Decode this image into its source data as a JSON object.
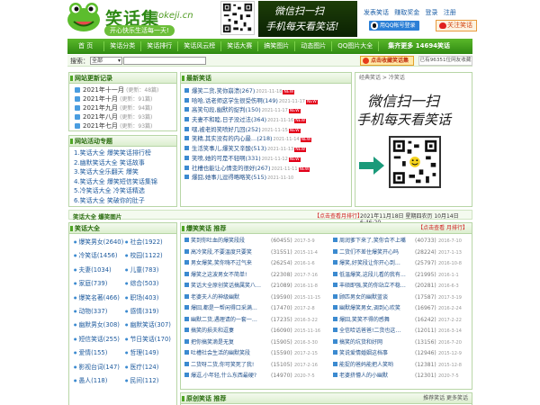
{
  "header": {
    "logo_cn": "笑话集",
    "logo_en": "Jokeji.cn",
    "slogan": "开心快乐生活每一天!",
    "banner_line1": "微信扫一扫",
    "banner_line2": "手机每天看笑话!",
    "links": [
      "发表笑话",
      "赚取奖金",
      "登录",
      "注册"
    ],
    "qq_login": "用QQ帐号登录",
    "weibo_follow": "关注笑话"
  },
  "nav": {
    "items": [
      "首 页",
      "笑话分类",
      "笑话排行",
      "笑话风云榜",
      "笑话大赛",
      "搞笑图片",
      "动态图片",
      "QQ图片大全",
      "集齐更多 14694笑话"
    ]
  },
  "search": {
    "label": "搜索：",
    "select_value": "全部",
    "input_value": ""
  },
  "favorite_button": "点击收藏笑话集",
  "online_count": "已有96351位网友收藏",
  "updates": {
    "title": "网站更新记录",
    "items": [
      {
        "month": "2021年十一月",
        "count": "(更新：48篇)"
      },
      {
        "month": "2021年十月",
        "count": "(更新：91篇)"
      },
      {
        "month": "2021年九月",
        "count": "(更新：94篇)"
      },
      {
        "month": "2021年八月",
        "count": "(更新：93篇)"
      },
      {
        "month": "2021年七月",
        "count": "(更新：93篇)"
      }
    ]
  },
  "topics": {
    "title": "网站活动专题",
    "items": [
      "1.笑话大全 爆笑笑话排行榜",
      "2.幽默笑话大全 笑话故事",
      "3.笑话大全乐翻天 爆笑",
      "4.笑话大全 爆笑短信笑话集锦",
      "5.冷笑话大全 冷笑话精选",
      "6.笑话大全 笑破你的肚子"
    ]
  },
  "latest": {
    "title": "最新笑话",
    "items": [
      {
        "title": "爆笑二货,笑你崩溃",
        "count": "(267)",
        "date": "2021-11-18",
        "new": "NEW"
      },
      {
        "title": "哈哈,话老师这学生很受伤啊",
        "count": "(149)",
        "date": "2021-11-17",
        "new": "NEW"
      },
      {
        "title": "高笑句段,幽默的捉判",
        "count": "(150)",
        "date": "2021-11-17",
        "new": "NEW"
      },
      {
        "title": "夫妻不和睦,日子没过法",
        "count": "(364)",
        "date": "2021-11-16",
        "new": "NEW"
      },
      {
        "title": "嘿,被老妈笑喷好几回",
        "count": "(252)",
        "date": "2021-11-15",
        "new": "NEW"
      },
      {
        "title": "笑精,其实没有的内心最…",
        "count": "(218)",
        "date": "2021-11-14",
        "new": "NEW"
      },
      {
        "title": "生活笑事儿,爆笑又辛酸",
        "count": "(513)",
        "date": "2021-11-13",
        "new": "NEW"
      },
      {
        "title": "笑喷,她的可是不轻啊",
        "count": "(331)",
        "date": "2021-11-12",
        "new": "NEW"
      },
      {
        "title": "社槽也能让心情变的很好",
        "count": "(267)",
        "date": "2021-11-11",
        "new": "NEW"
      },
      {
        "title": "爆囧,她事儿逗得略略笑",
        "count": "(515)",
        "date": "2021-11-10",
        "new": ""
      }
    ]
  },
  "promo": {
    "breadcrumb": "经典笑话 > 冷笑话",
    "line1": "微信扫一扫",
    "line2": "手机每天看笑话"
  },
  "timebar": {
    "title": "笑话大全 爆笑图片",
    "highlight": "【点击查看月排行】",
    "datetime": "2021年11月18日 星期四农历 10月14日 6:46:20"
  },
  "categories": {
    "title": "笑话大全",
    "items": [
      "爆笑男女(2640)",
      "社会(1922)",
      "冷笑话(1456)",
      "校园(1122)",
      "夫妻(1034)",
      "儿童(783)",
      "家庭(739)",
      "综合(503)",
      "爆笑名著(466)",
      "职场(403)",
      "动物(337)",
      "感情(319)",
      "幽默男女(308)",
      "幽默笑话(307)",
      "短信笑话(255)",
      "节日笑话(170)",
      "爱情(155)",
      "哲理(149)",
      "影视台词(147)",
      "医疗(124)",
      "愚人(118)",
      "民间(112)"
    ]
  },
  "hot": {
    "title": "爆笑笑话 推荐",
    "more": "【点击查看 月排行】",
    "left": [
      {
        "title": "笑到你吐血的爆笑段段",
        "views": "(60455)",
        "date": "2017-3-9"
      },
      {
        "title": "高冷笑段,不要温度只要笑",
        "views": "(31551)",
        "date": "2015-11-4"
      },
      {
        "title": "男女爆笑,笑你嗨不过气来",
        "views": "(26254)",
        "date": "2016-1-6"
      },
      {
        "title": "爆笑之这波男女不简单!",
        "views": "(22308)",
        "date": "2017-7-16"
      },
      {
        "title": "笑话大全原创笑话搞属笑八…",
        "views": "(21089)",
        "date": "2016-11-8"
      },
      {
        "title": "老婆夫人的神级幽默",
        "views": "(19590)",
        "date": "2015-11-15"
      },
      {
        "title": "爆囧,都是一帮闲得口采满…",
        "views": "(17470)",
        "date": "2017-2-8"
      },
      {
        "title": "幽默二货,遇理请的一套一…",
        "views": "(17235)",
        "date": "2016-3-22"
      },
      {
        "title": "搞笑的损夫和逗妻",
        "views": "(16090)",
        "date": "2015-11-16"
      },
      {
        "title": "把你搞笑滴是无复",
        "views": "(15905)",
        "date": "2016-3-30"
      },
      {
        "title": "吐槽社会生活的幽默笑段",
        "views": "(15590)",
        "date": "2017-2-15"
      },
      {
        "title": "二货呀二货,你可笑死了我!",
        "views": "(15105)",
        "date": "2017-2-16"
      },
      {
        "title": "爆逗,小年轻,什么东西最硬?",
        "views": "(14970)",
        "date": "2020-7-5"
      }
    ],
    "right": [
      {
        "title": "周润爹下来了,笑你合不上嘴",
        "views": "(40733)",
        "date": "2016-7-10"
      },
      {
        "title": "二货们不差住爆笑开心吗",
        "views": "(28224)",
        "date": "2017-1-13"
      },
      {
        "title": "爆笑,好笑段让你开心到…",
        "views": "(25797)",
        "date": "2016-10-8"
      },
      {
        "title": "低温爆笑,这段儿看的我有…",
        "views": "(21995)",
        "date": "2016-1-1"
      },
      {
        "title": "丰硕即强,笑的你站立不稳…",
        "views": "(20281)",
        "date": "2016-6-3"
      },
      {
        "title": "顾匹男女的幽默蓝谈",
        "views": "(17587)",
        "date": "2017-3-19"
      },
      {
        "title": "幽默爆笑男女,调到心欢笑",
        "views": "(16967)",
        "date": "2016-2-24"
      },
      {
        "title": "爆囧,笑笑不得的感舞",
        "views": "(16242)",
        "date": "2017-2-22"
      },
      {
        "title": "全信哈话爸爸!二货也这…",
        "views": "(12011)",
        "date": "2016-3-14"
      },
      {
        "title": "搞笑的坑货和好网",
        "views": "(13156)",
        "date": "2016-7-20"
      },
      {
        "title": "笑说爱情婚姻这档事",
        "views": "(12946)",
        "date": "2015-12-9"
      },
      {
        "title": "能捉的爸妈能把人笑哟",
        "views": "(12381)",
        "date": "2015-12-8"
      },
      {
        "title": "老婆挤懵人的小幽默",
        "views": "(12301)",
        "date": "2020-7-5"
      }
    ]
  },
  "orig": {
    "title": "原创笑话 推荐",
    "more": "推荐笑话 更多笑话"
  },
  "colors": {
    "brand_green": "#2f8a12",
    "nav_green": "#5ab82a",
    "link_blue": "#1f4f8a",
    "accent_red": "#d02020"
  }
}
